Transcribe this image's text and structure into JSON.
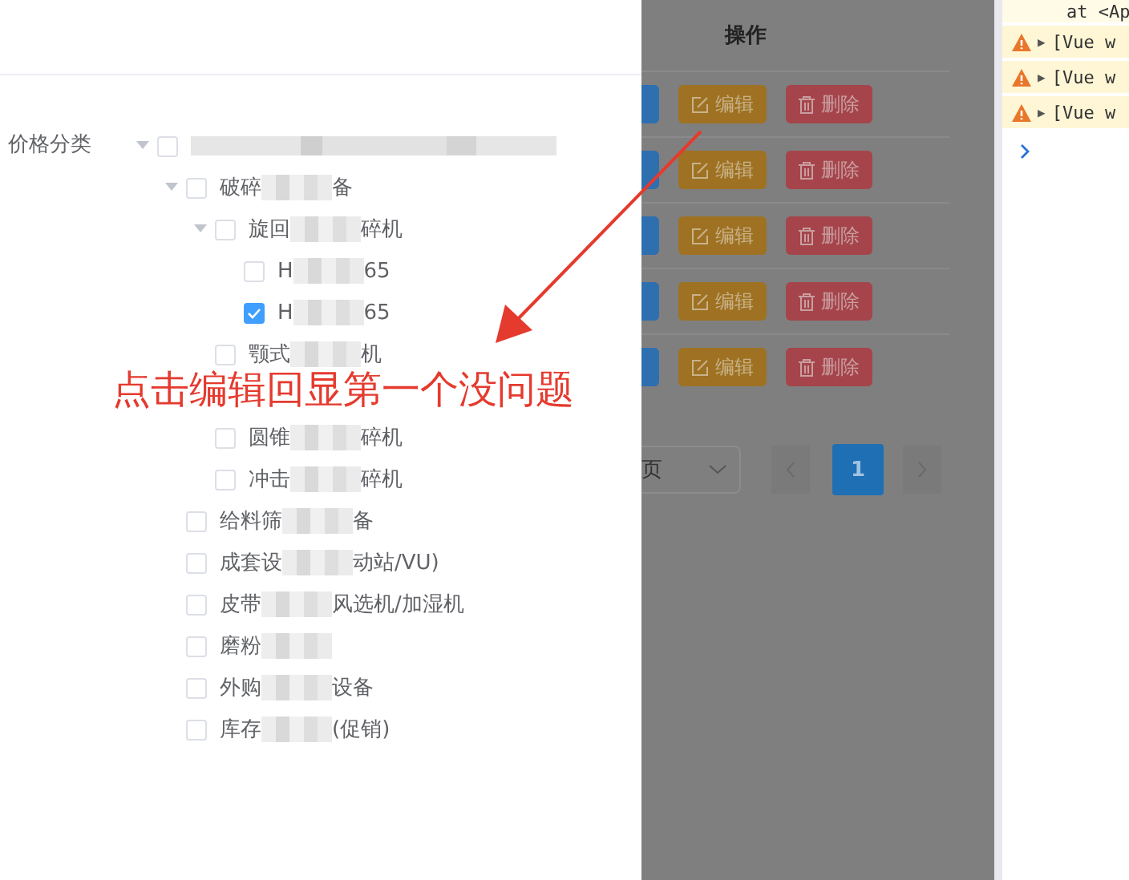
{
  "form": {
    "label": "价格分类"
  },
  "tree": [
    {
      "parts": [
        {
          "kind": "blur_long"
        }
      ],
      "checked": false,
      "expanded": true,
      "children": [
        {
          "parts": [
            {
              "kind": "text",
              "text": "破碎"
            },
            {
              "kind": "blur"
            },
            {
              "kind": "text",
              "text": "备"
            }
          ],
          "checked": false,
          "expanded": true,
          "children": [
            {
              "parts": [
                {
                  "kind": "text",
                  "text": "旋回"
                },
                {
                  "kind": "blur"
                },
                {
                  "kind": "text",
                  "text": "碎机"
                }
              ],
              "checked": false,
              "expanded": true,
              "children": [
                {
                  "parts": [
                    {
                      "kind": "text",
                      "text": "H"
                    },
                    {
                      "kind": "blur"
                    },
                    {
                      "kind": "text",
                      "text": "65"
                    }
                  ],
                  "checked": false
                },
                {
                  "parts": [
                    {
                      "kind": "text",
                      "text": "H"
                    },
                    {
                      "kind": "blur"
                    },
                    {
                      "kind": "text",
                      "text": "65"
                    }
                  ],
                  "checked": true
                }
              ]
            },
            {
              "parts": [
                {
                  "kind": "text",
                  "text": "颚式"
                },
                {
                  "kind": "blur"
                },
                {
                  "kind": "text",
                  "text": "机"
                }
              ],
              "checked": false
            },
            {
              "covered": true
            },
            {
              "parts": [
                {
                  "kind": "text",
                  "text": "圆锥"
                },
                {
                  "kind": "blur"
                },
                {
                  "kind": "text",
                  "text": "碎机"
                }
              ],
              "checked": false
            },
            {
              "parts": [
                {
                  "kind": "text",
                  "text": "冲击"
                },
                {
                  "kind": "blur"
                },
                {
                  "kind": "text",
                  "text": "碎机"
                }
              ],
              "checked": false
            }
          ]
        },
        {
          "parts": [
            {
              "kind": "text",
              "text": "给料筛"
            },
            {
              "kind": "blur"
            },
            {
              "kind": "text",
              "text": "备"
            }
          ],
          "checked": false
        },
        {
          "parts": [
            {
              "kind": "text",
              "text": "成套设"
            },
            {
              "kind": "blur"
            },
            {
              "kind": "text",
              "text": "动站/VU)"
            }
          ],
          "checked": false
        },
        {
          "parts": [
            {
              "kind": "text",
              "text": "皮带"
            },
            {
              "kind": "blur"
            },
            {
              "kind": "text",
              "text": "风选机/加湿机"
            }
          ],
          "checked": false
        },
        {
          "parts": [
            {
              "kind": "text",
              "text": "磨粉"
            },
            {
              "kind": "blur"
            }
          ],
          "checked": false
        },
        {
          "parts": [
            {
              "kind": "text",
              "text": "外购"
            },
            {
              "kind": "blur"
            },
            {
              "kind": "text",
              "text": "设备"
            }
          ],
          "checked": false
        },
        {
          "parts": [
            {
              "kind": "text",
              "text": "库存"
            },
            {
              "kind": "blur"
            },
            {
              "kind": "text",
              "text": "(促销)"
            }
          ],
          "checked": false
        }
      ]
    }
  ],
  "note": "点击编辑回显第一个没问题",
  "table": {
    "header": "操作",
    "rows": [
      {
        "edit": "编辑",
        "delete": "删除"
      },
      {
        "edit": "编辑",
        "delete": "删除"
      },
      {
        "edit": "编辑",
        "delete": "删除"
      },
      {
        "edit": "编辑",
        "delete": "删除"
      },
      {
        "edit": "编辑",
        "delete": "删除"
      }
    ]
  },
  "pagination": {
    "page_size": "页",
    "pages": [
      {
        "label": "1",
        "selected": true
      }
    ]
  },
  "console": {
    "lines": [
      {
        "kind": "trace",
        "text": "at <Ap"
      },
      {
        "kind": "warning",
        "toggle": "▶",
        "text": "[Vue w"
      },
      {
        "kind": "warning",
        "toggle": "▶",
        "text": "[Vue w"
      },
      {
        "kind": "warning",
        "toggle": "▶",
        "text": "[Vue w"
      }
    ]
  }
}
